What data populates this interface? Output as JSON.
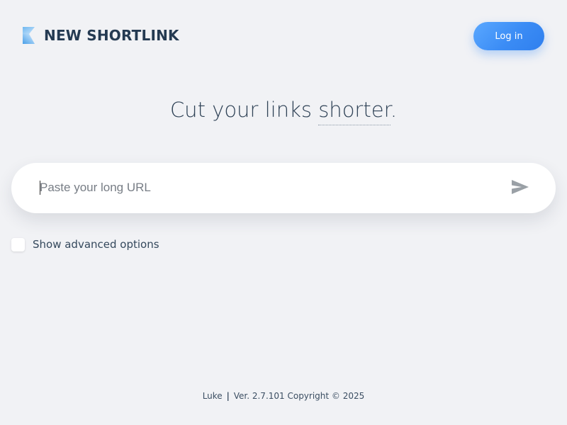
{
  "header": {
    "logo_icon": "shortlink-logo-icon",
    "brand_name": "NEW SHORTLINK",
    "login_label": "Log in"
  },
  "hero": {
    "headline_prefix": "Cut your links ",
    "headline_underlined": "shorter",
    "headline_suffix": "."
  },
  "url_form": {
    "placeholder": "Paste your long URL",
    "value": "",
    "submit_icon": "send-icon"
  },
  "advanced": {
    "label": "Show advanced options",
    "checked": false
  },
  "footer": {
    "author": "Luke",
    "separator": "|",
    "version_text": "Ver. 2.7.101 Copyright © 2025"
  },
  "colors": {
    "background": "#f1f2f5",
    "accent": "#3b8cf5",
    "text_dark": "#243a52",
    "send_icon": "#9aa0a6"
  }
}
